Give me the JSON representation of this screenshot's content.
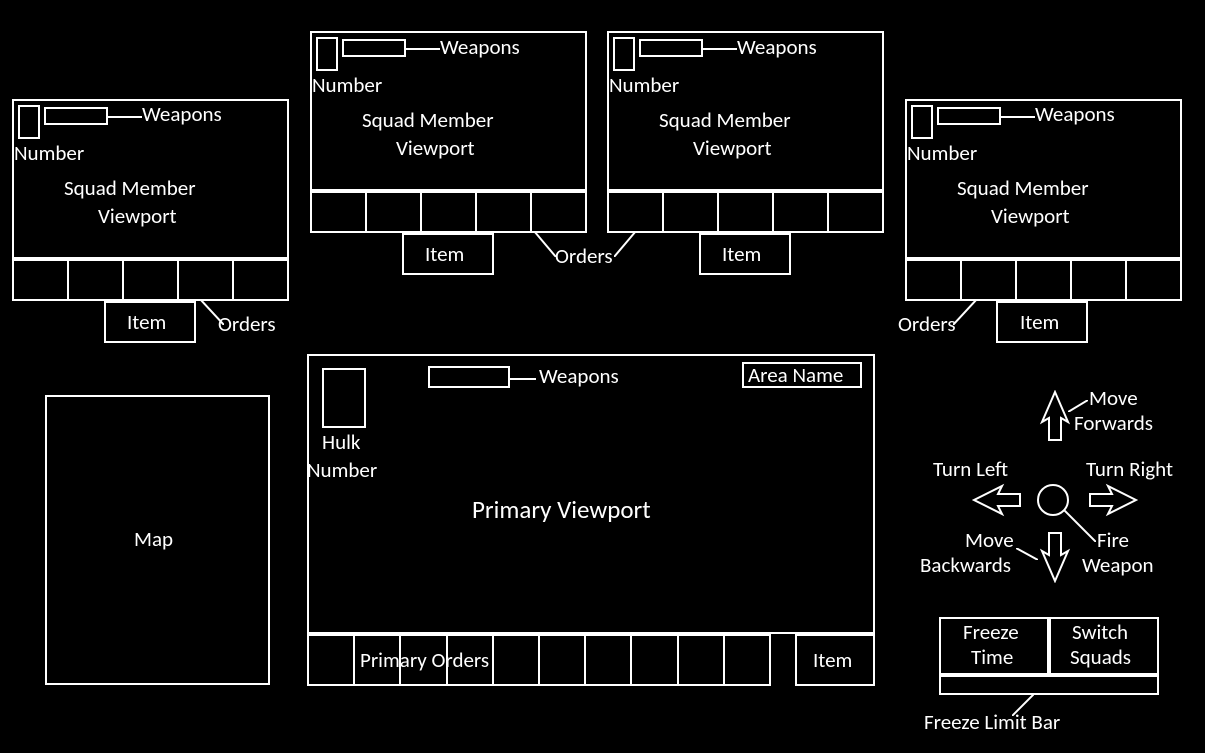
{
  "squad_panel": {
    "weapons_label": "Weapons",
    "number_label": "Number",
    "title_line1": "Squad Member",
    "title_line2": "Viewport",
    "orders_label": "Orders",
    "item_label": "Item"
  },
  "primary_panel": {
    "weapons_label": "Weapons",
    "area_name_label": "Area Name",
    "hulk_line1": "Hulk",
    "hulk_line2": "Number",
    "title": "Primary Viewport",
    "orders_label": "Primary Orders",
    "item_label": "Item"
  },
  "map_label": "Map",
  "controls": {
    "move_forwards_l1": "Move",
    "move_forwards_l2": "Forwards",
    "turn_left": "Turn Left",
    "turn_right": "Turn Right",
    "fire_l1": "Fire",
    "fire_l2": "Weapon",
    "move_back_l1": "Move",
    "move_back_l2": "Backwards"
  },
  "bottom_controls": {
    "freeze_l1": "Freeze",
    "freeze_l2": "Time",
    "switch_l1": "Switch",
    "switch_l2": "Squads",
    "freeze_bar_label": "Freeze Limit Bar"
  }
}
